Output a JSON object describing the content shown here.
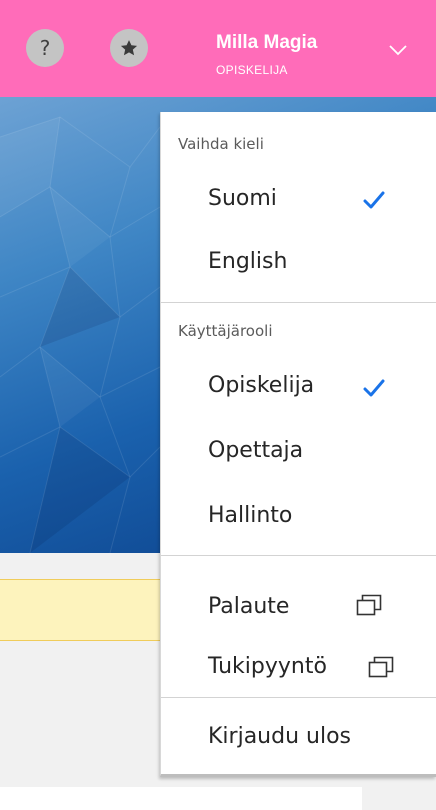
{
  "header": {
    "help_icon_glyph": "?",
    "user_name": "Milla Magia",
    "user_role": "OPISKELIJA"
  },
  "menu": {
    "language_section_label": "Vaihda kieli",
    "languages": [
      {
        "label": "Suomi",
        "selected": true
      },
      {
        "label": "English",
        "selected": false
      }
    ],
    "role_section_label": "Käyttäjärooli",
    "roles": [
      {
        "label": "Opiskelija",
        "selected": true
      },
      {
        "label": "Opettaja",
        "selected": false
      },
      {
        "label": "Hallinto",
        "selected": false
      }
    ],
    "links": [
      {
        "label": "Palaute",
        "icon": "external-window-icon"
      },
      {
        "label": "Tukipyyntö",
        "icon": "external-window-icon"
      }
    ],
    "logout_label": "Kirjaudu ulos"
  },
  "colors": {
    "header_bg": "#ff6cb9",
    "check_color": "#1a73e8",
    "notice_bg": "#fdf3bd"
  }
}
